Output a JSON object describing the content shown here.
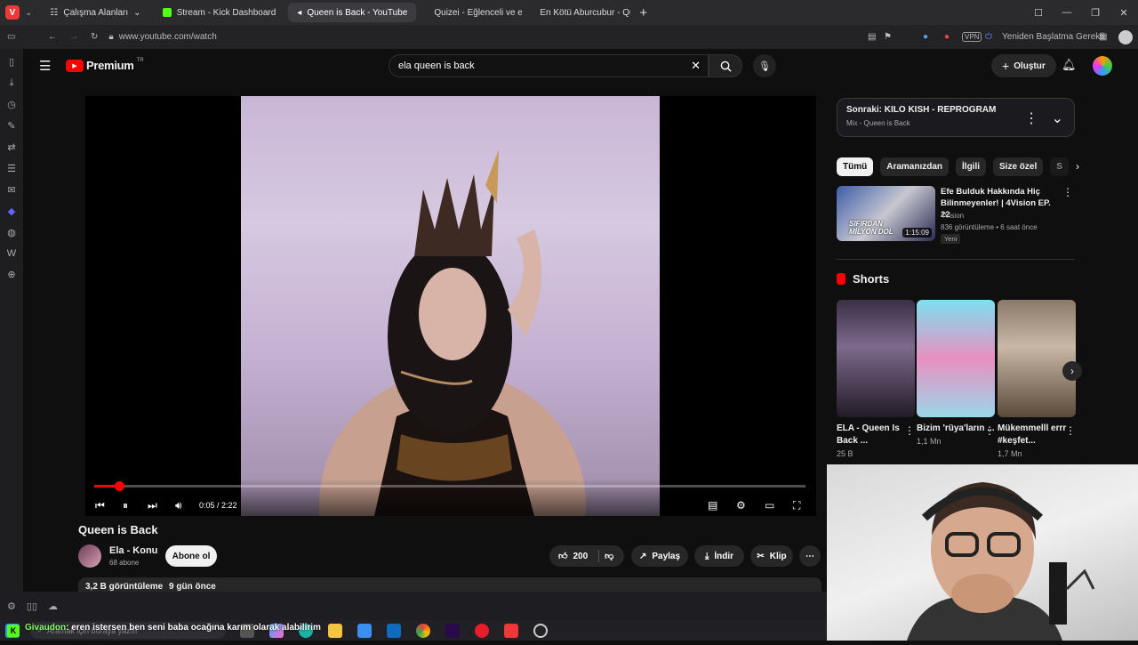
{
  "browser": {
    "workspaces": "Çalışma Alanları",
    "tabs": [
      {
        "label": "Stream - Kick Dashboard",
        "color": "#53fc18"
      },
      {
        "label": "Queen is Back - YouTube",
        "color": "#ff0000"
      },
      {
        "label": "Quizei - Eğlenceli ve etkile",
        "color": "#7b61ff"
      },
      {
        "label": "En Kötü Aburcubur - Quize",
        "color": "#7b61ff"
      }
    ],
    "url": "www.youtube.com/watch",
    "restart": "Yeniden Başlatma Gerekli",
    "vpn": "VPN"
  },
  "youtube": {
    "logo": "Premium",
    "logo_region": "TR",
    "search_value": "ela queen is back",
    "create": "Oluştur",
    "video": {
      "time": "0:05 / 2:22",
      "progress": 0.035,
      "title": "Queen is Back"
    },
    "channel": {
      "name": "Ela - Konu",
      "subs": "68 abone",
      "subscribe": "Abone ol"
    },
    "actions": {
      "likes": "200",
      "share": "Paylaş",
      "download": "İndir",
      "clip": "Klip"
    },
    "description": {
      "views": "3,2 B görüntüleme",
      "age": "9 gün önce"
    },
    "up_next": {
      "title": "Sonraki: KILO KISH - REPROGRAM",
      "sub": "Mix - Queen is Back"
    },
    "chips": [
      "Tümü",
      "Aramanızdan",
      "İlgili",
      "Size özel",
      "S"
    ],
    "rec_video": {
      "title": "Efe Bulduk Hakkında Hiç Bilinmeyenler! | 4Vision EP. 22",
      "channel": "4Vision",
      "meta": "836 görüntüleme • 6 saat önce",
      "badge": "Yeni",
      "duration": "1:15:09",
      "thumb_text": "SIFIRDAN MİLYON DOL"
    },
    "shorts_title": "Shorts",
    "shorts": [
      {
        "title": "ELA - Queen Is Back ...",
        "views": "25 B"
      },
      {
        "title": "Bizim 'rüya'ların ...",
        "views": "1,1 Mn"
      },
      {
        "title": "Mükemmelll errr #keşfet...",
        "views": "1,7 Mn"
      }
    ]
  },
  "overlay": {
    "search_placeholder": "Aramak için buraya yazın",
    "ticker_user": "Givaudon",
    "ticker_text": ": eren istersen ben seni baba ocağına karım olarak alabilirim"
  }
}
